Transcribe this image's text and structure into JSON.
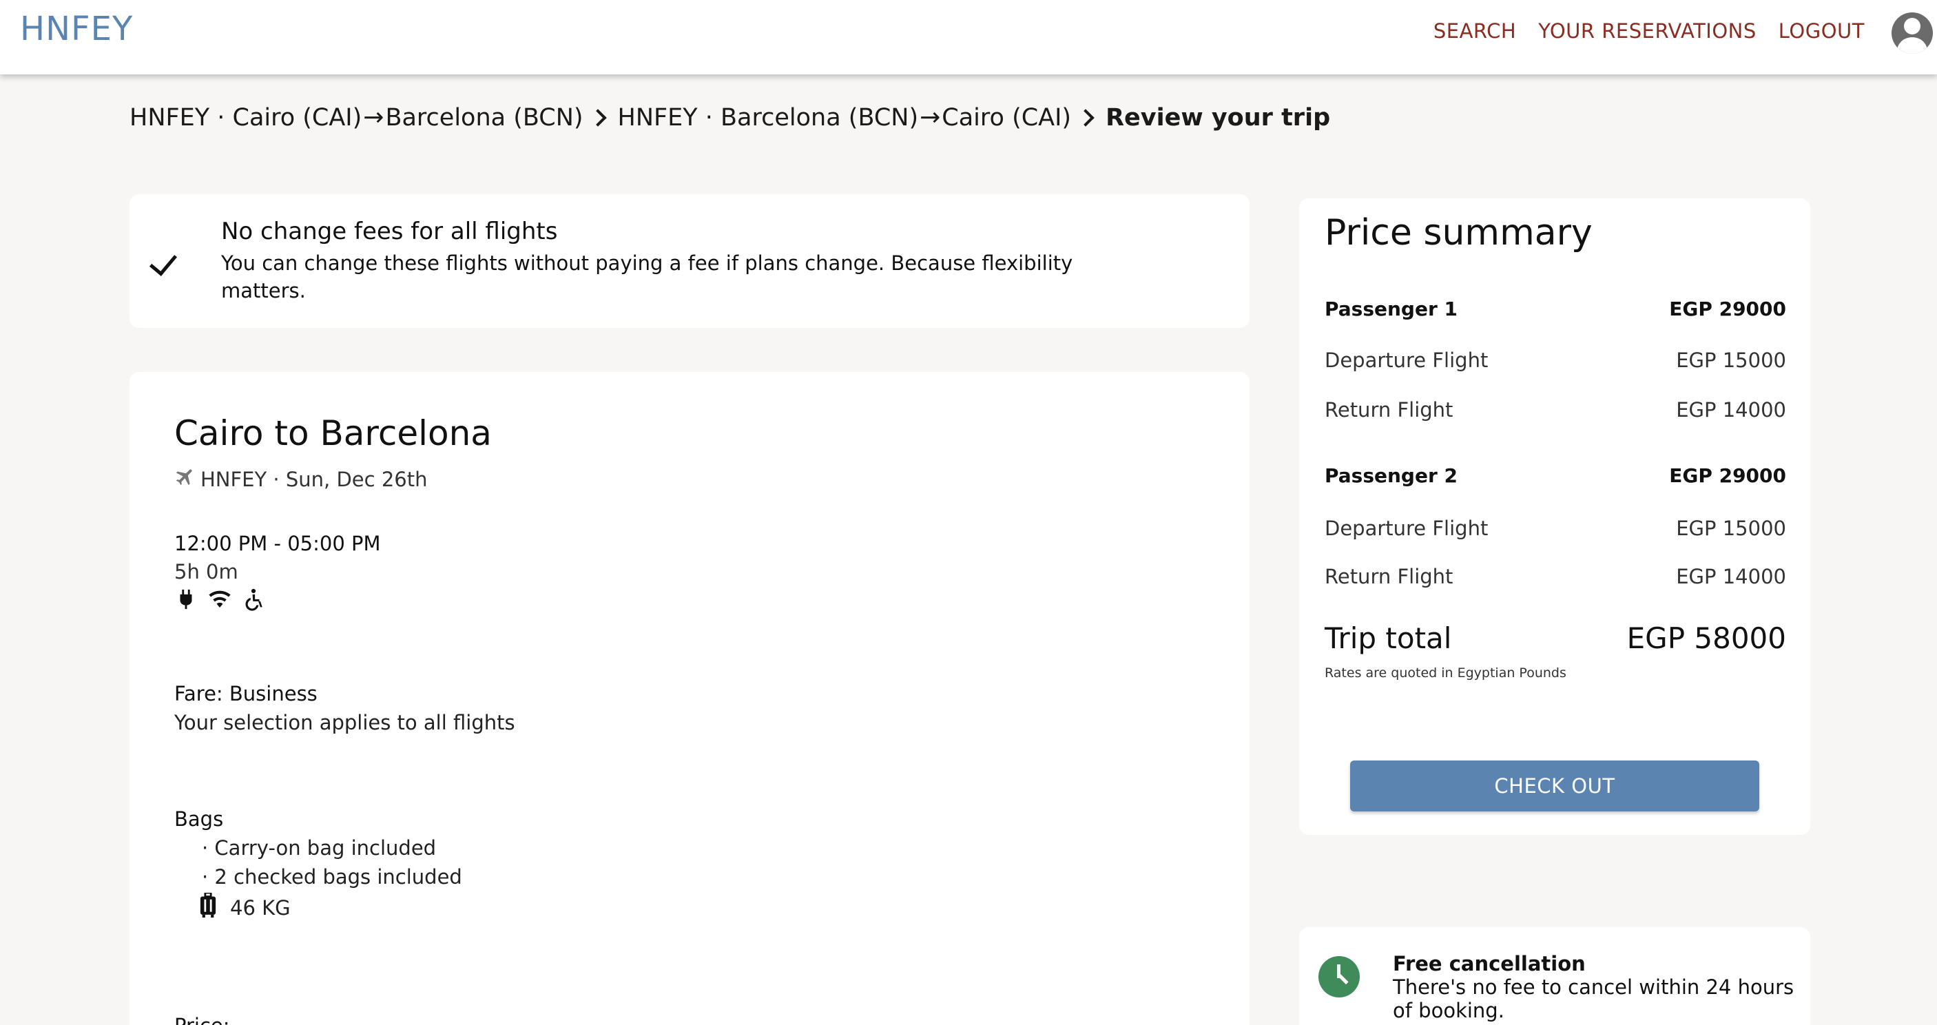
{
  "header": {
    "logo": "HNFEY",
    "nav": [
      "SEARCH",
      "YOUR RESERVATIONS",
      "LOGOUT"
    ]
  },
  "breadcrumb": {
    "step1_airline": "HNFEY · Cairo (CAI)",
    "step1_dest": "Barcelona (BCN)",
    "step2_airline": "HNFEY · Barcelona (BCN)",
    "step2_dest": "Cairo (CAI)",
    "current": "Review your trip"
  },
  "nofee": {
    "title": "No change fees for all flights",
    "desc": "You can change these flights without paying a fee if plans change. Because flexibility matters."
  },
  "flight": {
    "route": "Cairo to Barcelona",
    "airline_date": "HNFEY · Sun, Dec 26th",
    "times": "12:00 PM - 05:00 PM",
    "duration": "5h 0m",
    "amenity_icons": [
      "power-plug-icon",
      "wifi-icon",
      "wheelchair-accessible-icon"
    ],
    "fare": "Fare: Business",
    "fare_note": "Your selection applies to all flights",
    "bags_title": "Bags",
    "bag_items": [
      "· Carry-on bag included",
      "· 2 checked bags included"
    ],
    "weight": "46 KG",
    "price_label": "Price:"
  },
  "summary": {
    "title": "Price summary",
    "passenger1": {
      "label": "Passenger 1",
      "total": "EGP 29000",
      "departure_label": "Departure Flight",
      "departure": "EGP 15000",
      "return_label": "Return Flight",
      "return": "EGP 14000"
    },
    "passenger2": {
      "label": "Passenger 2",
      "total": "EGP 29000",
      "departure_label": "Departure Flight",
      "departure": "EGP 15000",
      "return_label": "Return Flight",
      "return": "EGP 14000"
    },
    "total_label": "Trip total",
    "total": "EGP 58000",
    "rates_note": "Rates are quoted in Egyptian Pounds",
    "checkout": "CHECK OUT"
  },
  "cancel": {
    "title": "Free cancellation",
    "desc": "There's no fee to cancel within 24 hours of booking."
  },
  "colors": {
    "brand_blue": "#5b85b0",
    "nav_red": "#8b2c21",
    "success_green": "#3f8b5a",
    "page_bg": "#f8f6f5"
  }
}
